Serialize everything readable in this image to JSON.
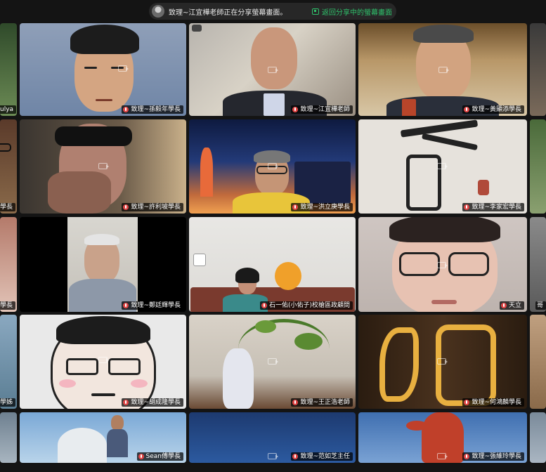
{
  "banner": {
    "text": "致理~江宜樺老師正在分享螢幕畫面。",
    "return_label": "返回分享中的螢幕畫面"
  },
  "edge_labels": {
    "r1": "ulya",
    "r2": "學長",
    "r3": "學長",
    "r4": "學姊",
    "right_r3": "哥"
  },
  "tiles": {
    "r1c1": "致理~孫毅年學長",
    "r1c2": "致理~江宜樺老師",
    "r1c3": "致理~黃顯添學長",
    "r2c1": "致理~許利坡學長",
    "r2c2": "致理~洪立庚學長",
    "r2c3": "致理~李家宏學長",
    "r3c1": "致理~鄭廷輝學長",
    "r3c2": "石一佑(小佑子)校槍區政顧問",
    "r3c3": "天立",
    "r4c1": "致理~胡成隆學長",
    "r4c2": "致理~王正浩老師",
    "r4c3": "致理~何鴻麟學長",
    "r5c1": "Sean傅學長",
    "r5c2": "致理~范如芝主任",
    "r5c3": "致理~張維玲學長"
  }
}
